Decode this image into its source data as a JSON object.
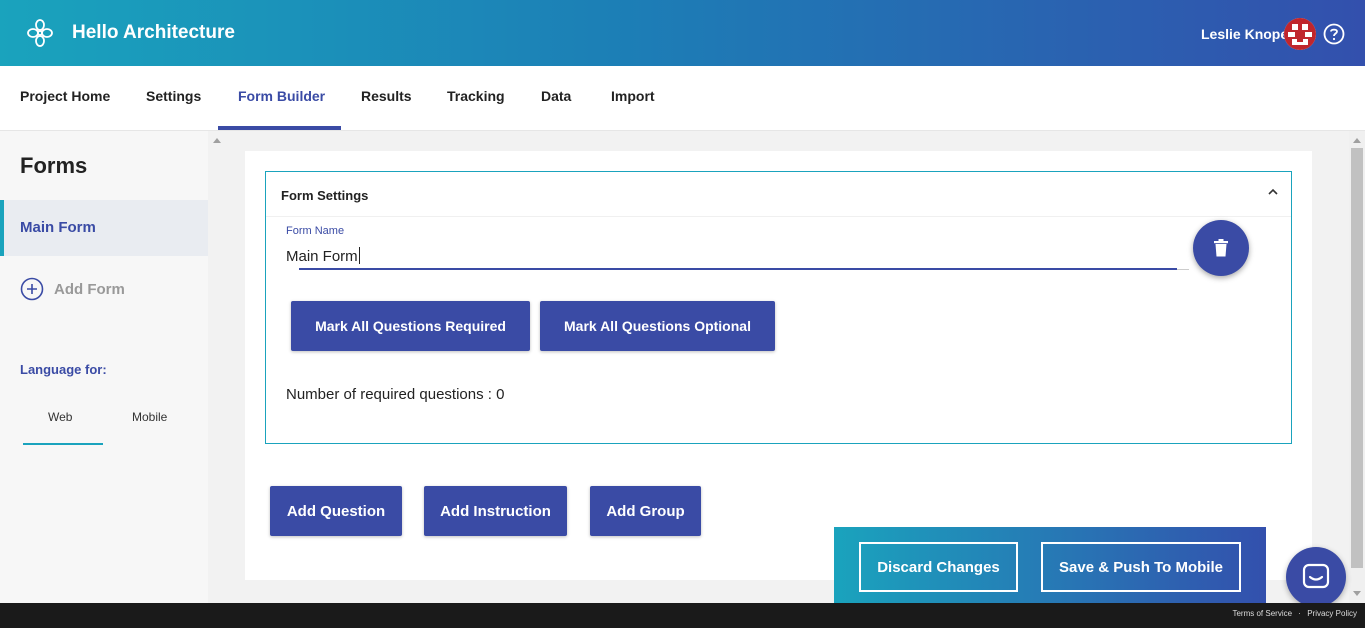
{
  "header": {
    "app_title": "Hello Architecture",
    "user_name": "Leslie Knope",
    "logo_icon": "flower-logo-icon",
    "help_icon": "help-circle-icon"
  },
  "nav": {
    "items": [
      "Project Home",
      "Settings",
      "Form Builder",
      "Results",
      "Tracking",
      "Data",
      "Import"
    ],
    "active": "Form Builder"
  },
  "sidebar": {
    "title": "Forms",
    "forms": [
      "Main Form"
    ],
    "add_form_label": "Add Form",
    "language_label": "Language for:",
    "language_tabs": [
      "Web",
      "Mobile"
    ],
    "active_language_tab": "Web"
  },
  "form_settings": {
    "title": "Form Settings",
    "form_name_label": "Form Name",
    "form_name_value": "Main Form",
    "mark_required_label": "Mark All Questions Required",
    "mark_optional_label": "Mark All Questions Optional",
    "required_count_text": "Number of required questions : 0"
  },
  "actions": {
    "add_question": "Add Question",
    "add_instruction": "Add Instruction",
    "add_group": "Add Group",
    "discard_changes": "Discard Changes",
    "save_push": "Save & Push To Mobile"
  },
  "footer": {
    "terms": "Terms of Service",
    "privacy": "Privacy Policy"
  },
  "colors": {
    "accent": "#3a4ba5",
    "teal": "#1aa3bd"
  }
}
